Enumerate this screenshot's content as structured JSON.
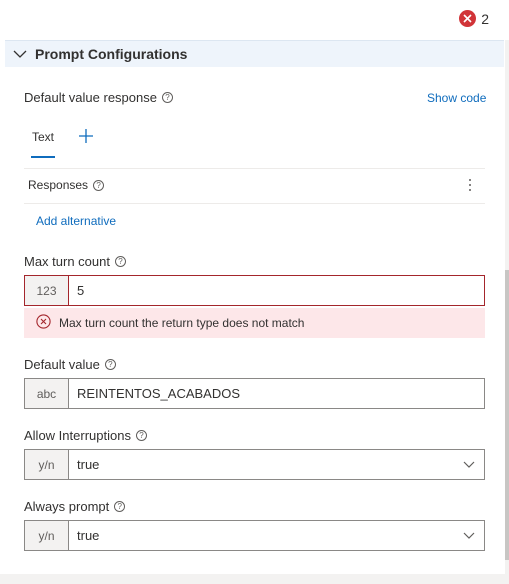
{
  "header": {
    "error_count": "2"
  },
  "section": {
    "title": "Prompt Configurations"
  },
  "default_value_response": {
    "label": "Default value response",
    "show_code": "Show code",
    "tabs": [
      {
        "label": "Text"
      }
    ],
    "responses_label": "Responses",
    "add_alternative": "Add alternative"
  },
  "max_turn_count": {
    "label": "Max turn count",
    "prefix": "123",
    "value": "5",
    "error": "Max turn count the return type does not match"
  },
  "default_value": {
    "label": "Default value",
    "prefix": "abc",
    "value": "REINTENTOS_ACABADOS"
  },
  "allow_interruptions": {
    "label": "Allow Interruptions",
    "prefix": "y/n",
    "value": "true"
  },
  "always_prompt": {
    "label": "Always prompt",
    "prefix": "y/n",
    "value": "true"
  },
  "help_glyph": "?",
  "colors": {
    "accent": "#0f6cbd",
    "error": "#d13438",
    "error_bg": "#fde7e9",
    "section_bg": "#eef4fb"
  }
}
